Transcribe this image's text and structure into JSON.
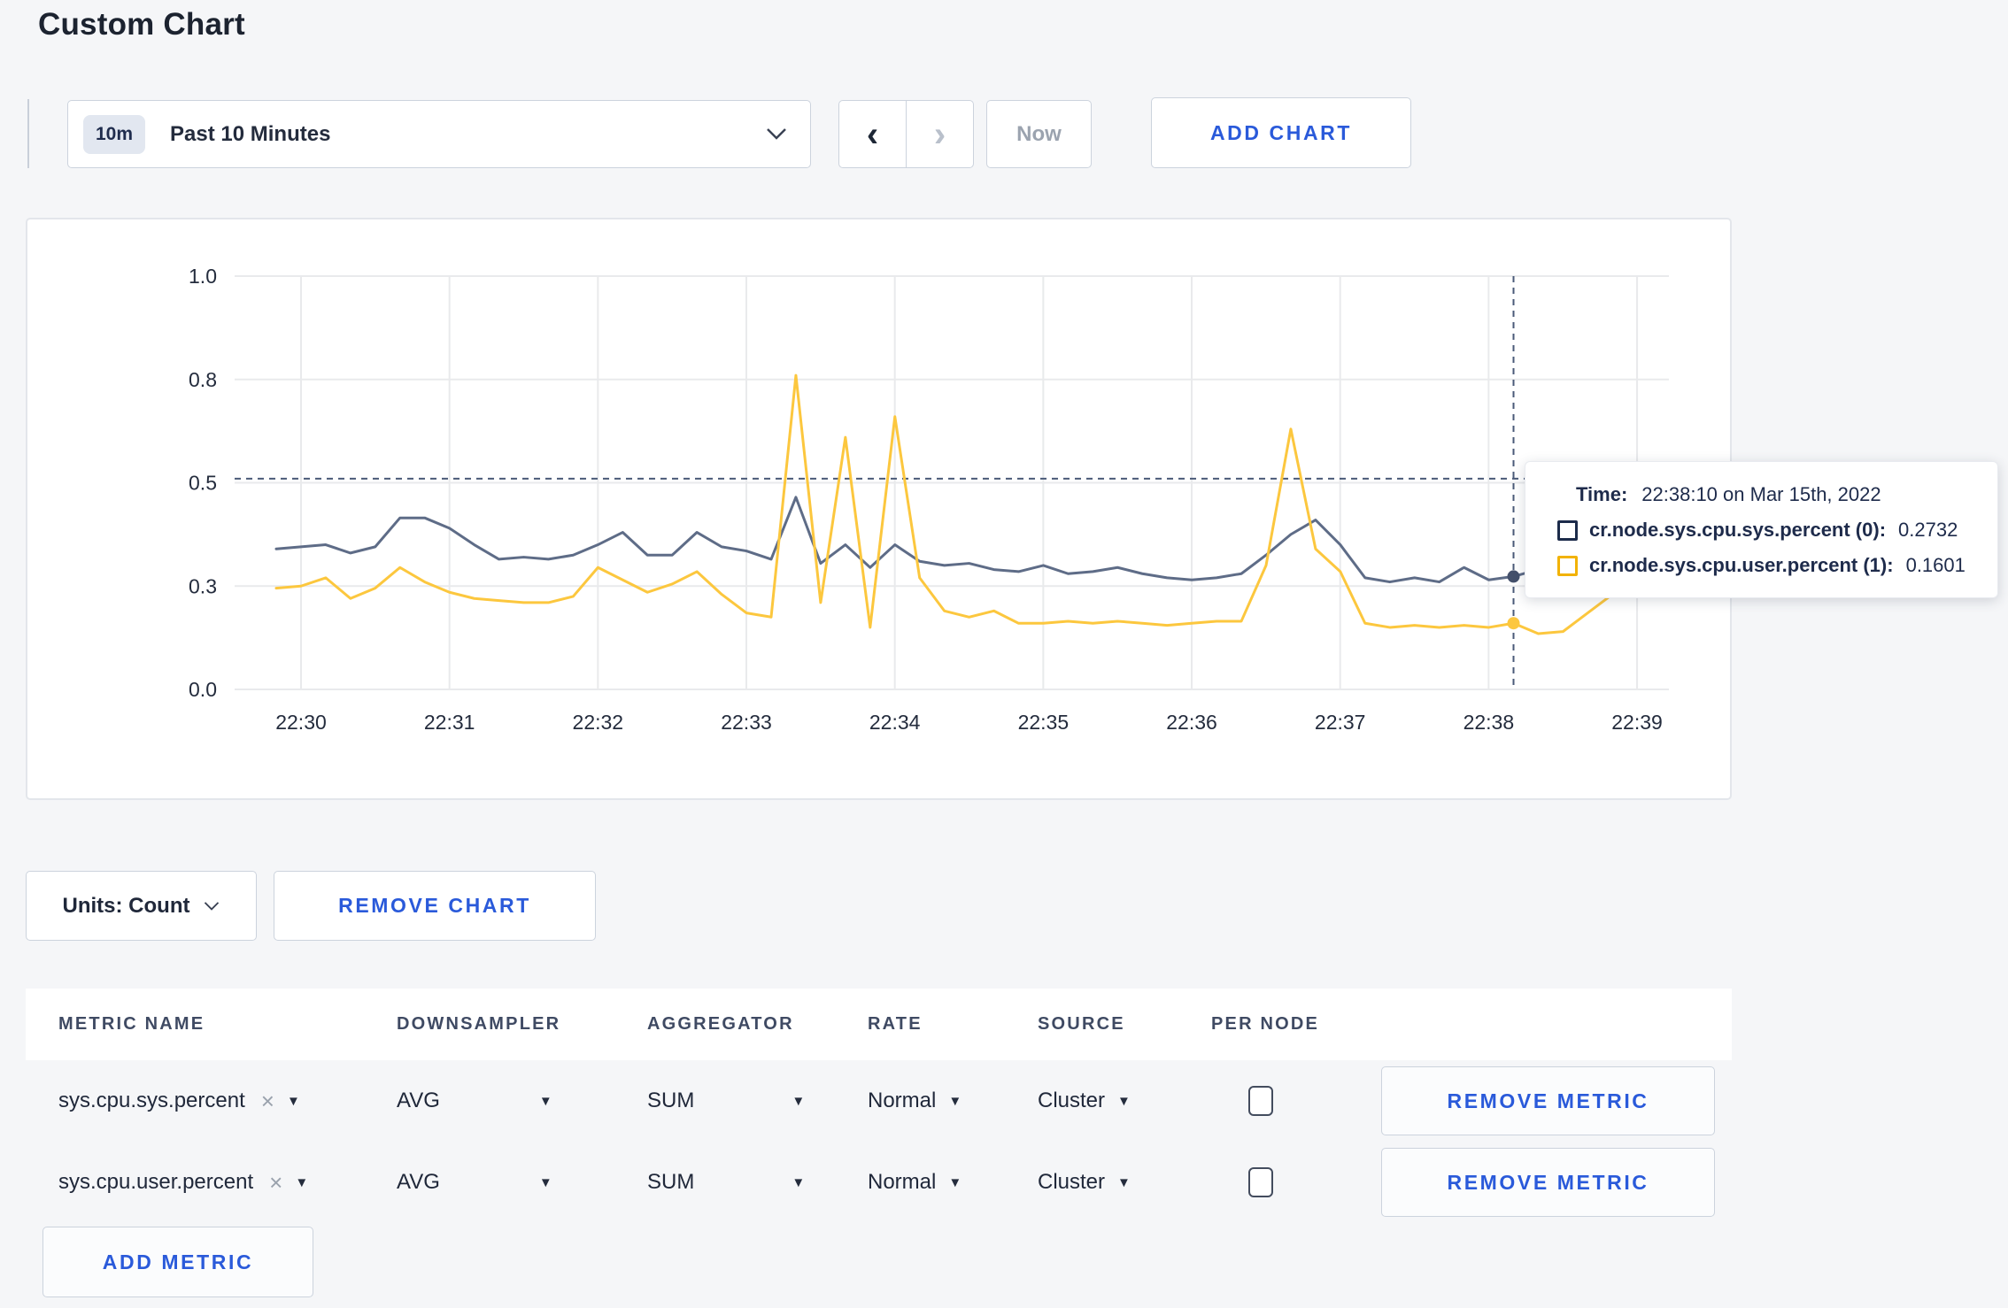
{
  "page": {
    "title": "Custom Chart"
  },
  "toolbar": {
    "range_badge": "10m",
    "range_label": "Past 10 Minutes",
    "prev_label": "‹",
    "next_label": "›",
    "now_label": "Now",
    "add_chart_label": "ADD CHART"
  },
  "chart_data": {
    "type": "line",
    "title": "",
    "xlabel": "",
    "ylabel": "",
    "ylim": [
      0,
      1
    ],
    "grid": true,
    "x_start_time": "22:29:50",
    "x_step_seconds": 10,
    "y_axis": {
      "ticks": [
        {
          "v": 0.0,
          "label": "0.0"
        },
        {
          "v": 0.25,
          "label": "0.3"
        },
        {
          "v": 0.5,
          "label": "0.5"
        },
        {
          "v": 0.75,
          "label": "0.8"
        },
        {
          "v": 1.0,
          "label": "1.0"
        }
      ]
    },
    "x_axis": {
      "ticks": [
        "22:30",
        "22:31",
        "22:32",
        "22:33",
        "22:34",
        "22:35",
        "22:36",
        "22:37",
        "22:38",
        "22:39"
      ]
    },
    "series": [
      {
        "name": "cr.node.sys.cpu.sys.percent (0)",
        "color": "#5e6c87",
        "legend_color": "#1c2b4a",
        "values": [
          0.34,
          0.345,
          0.35,
          0.33,
          0.345,
          0.415,
          0.415,
          0.39,
          0.35,
          0.315,
          0.32,
          0.315,
          0.325,
          0.35,
          0.38,
          0.325,
          0.325,
          0.38,
          0.345,
          0.335,
          0.315,
          0.465,
          0.305,
          0.35,
          0.295,
          0.35,
          0.31,
          0.3,
          0.305,
          0.29,
          0.285,
          0.3,
          0.28,
          0.285,
          0.295,
          0.28,
          0.27,
          0.265,
          0.27,
          0.28,
          0.325,
          0.375,
          0.41,
          0.35,
          0.27,
          0.26,
          0.27,
          0.26,
          0.295,
          0.265,
          0.2732,
          0.29,
          0.3,
          0.295,
          0.3,
          0.3,
          0.25
        ]
      },
      {
        "name": "cr.node.sys.cpu.user.percent (1)",
        "color": "#fcc73e",
        "legend_color": "#f2b204",
        "values": [
          0.245,
          0.25,
          0.27,
          0.22,
          0.245,
          0.295,
          0.26,
          0.235,
          0.22,
          0.215,
          0.21,
          0.21,
          0.225,
          0.295,
          0.265,
          0.235,
          0.255,
          0.285,
          0.23,
          0.185,
          0.175,
          0.76,
          0.21,
          0.61,
          0.15,
          0.66,
          0.27,
          0.19,
          0.175,
          0.19,
          0.16,
          0.16,
          0.165,
          0.16,
          0.165,
          0.16,
          0.155,
          0.16,
          0.165,
          0.165,
          0.3,
          0.63,
          0.34,
          0.285,
          0.16,
          0.15,
          0.155,
          0.15,
          0.155,
          0.15,
          0.1601,
          0.135,
          0.14,
          0.185,
          0.23,
          0.265,
          0.28
        ]
      }
    ],
    "hover": {
      "index": 50,
      "crosshair_y": 0.51,
      "time": "22:38:10"
    },
    "legend_position": "tooltip"
  },
  "tooltip": {
    "time_label": "Time:",
    "time_value": "22:38:10 on Mar 15th, 2022",
    "rows": [
      {
        "name": "cr.node.sys.cpu.sys.percent (0):",
        "value": "0.2732",
        "color": "#1c2b4a"
      },
      {
        "name": "cr.node.sys.cpu.user.percent (1):",
        "value": "0.1601",
        "color": "#f2b204"
      }
    ]
  },
  "units_row": {
    "units_label": "Units: Count",
    "remove_chart_label": "REMOVE CHART"
  },
  "metrics_table": {
    "headers": [
      "METRIC NAME",
      "DOWNSAMPLER",
      "AGGREGATOR",
      "RATE",
      "SOURCE",
      "PER NODE"
    ],
    "rows": [
      {
        "metric": "sys.cpu.sys.percent",
        "downsampler": "AVG",
        "aggregator": "SUM",
        "rate": "Normal",
        "source": "Cluster",
        "per_node_checked": false,
        "remove_label": "REMOVE METRIC"
      },
      {
        "metric": "sys.cpu.user.percent",
        "downsampler": "AVG",
        "aggregator": "SUM",
        "rate": "Normal",
        "source": "Cluster",
        "per_node_checked": false,
        "remove_label": "REMOVE METRIC"
      }
    ],
    "add_metric_label": "ADD METRIC"
  }
}
